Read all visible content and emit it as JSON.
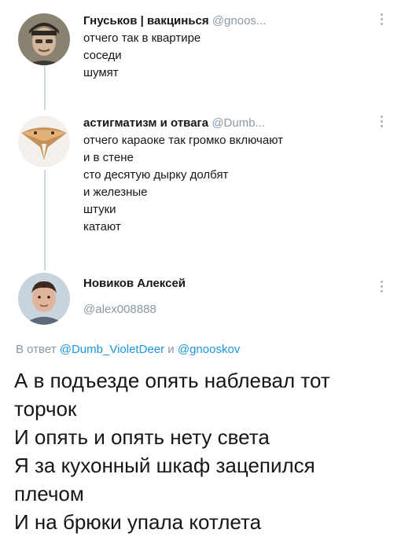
{
  "thread": [
    {
      "name": "Гнуськов | вакцинься",
      "handle": "@gnoos...",
      "lines": [
        "отчего так в квартире",
        "соседи",
        "шумят"
      ]
    },
    {
      "name": "астигматизм и отвага",
      "handle": "@Dumb...",
      "lines": [
        "отчего караоке так громко включают",
        "и в стене",
        "сто десятую дырку долбят",
        "и железные",
        "штуки",
        "катают"
      ]
    }
  ],
  "main_tweet": {
    "name": "Новиков Алексей",
    "handle": "@alex008888",
    "reply_prefix": "В ответ",
    "reply_user1": "@Dumb_VioletDeer",
    "reply_and": "и",
    "reply_user2": "@gnooskov",
    "lines": [
      "А в подъезде опять наблевал тот",
      "торчок",
      "И опять и опять нету света",
      "Я за кухонный шкаф зацепился",
      "плечом",
      "И на брюки упала котлета"
    ]
  },
  "colors": {
    "handle_gray": "#8899a6",
    "link_blue": "#1b95e0",
    "thread_line": "#cfd9de"
  }
}
